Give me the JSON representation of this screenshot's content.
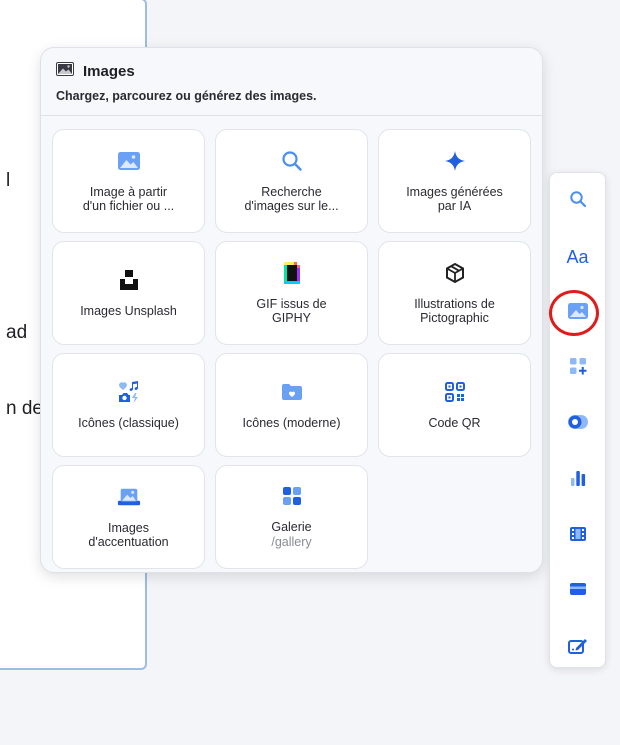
{
  "background_doc": {
    "fragments": [
      "l",
      "ad",
      "n de"
    ]
  },
  "popover": {
    "title": "Images",
    "subtitle": "Chargez, parcourez ou générez des images.",
    "tiles": [
      {
        "label": "Image à partir\nd'un fichier ou ...",
        "icon": "image-icon"
      },
      {
        "label": "Recherche\nd'images sur le...",
        "icon": "search-icon"
      },
      {
        "label": "Images générées\npar IA",
        "icon": "sparkle-icon"
      },
      {
        "label": "Images Unsplash",
        "icon": "unsplash-icon"
      },
      {
        "label": "GIF issus de\nGIPHY",
        "icon": "giphy-icon"
      },
      {
        "label": "Illustrations de\nPictographic",
        "icon": "pictographic-icon"
      },
      {
        "label": "Icônes (classique)",
        "icon": "icons-classic-icon"
      },
      {
        "label": "Icônes (moderne)",
        "icon": "icons-modern-icon"
      },
      {
        "label": "Code QR",
        "icon": "qr-code-icon"
      },
      {
        "label": "Images\nd'accentuation",
        "icon": "accent-image-icon"
      },
      {
        "label": "Galerie",
        "sub": "/gallery",
        "icon": "gallery-icon"
      }
    ]
  },
  "toolbar": {
    "text_button_label": "Aa",
    "items": [
      "search-icon",
      "text-icon",
      "image-icon",
      "add-block-icon",
      "toggle-icon",
      "chart-icon",
      "video-icon",
      "card-icon",
      "edit-icon"
    ],
    "active": "image-icon"
  },
  "colors": {
    "accent": "#2f6fe4",
    "highlight": "#e01b1b"
  }
}
